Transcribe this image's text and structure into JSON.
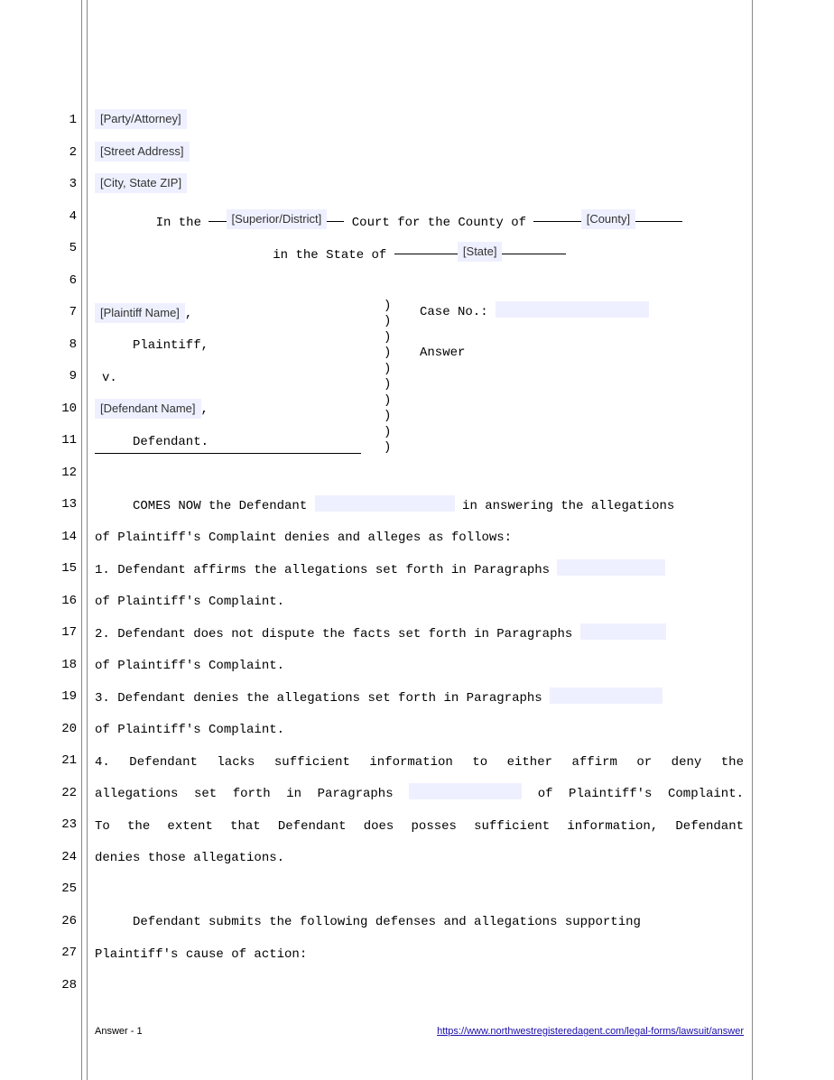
{
  "lineNumbers": [
    "1",
    "2",
    "3",
    "4",
    "5",
    "6",
    "7",
    "8",
    "9",
    "10",
    "11",
    "12",
    "13",
    "14",
    "15",
    "16",
    "17",
    "18",
    "19",
    "20",
    "21",
    "22",
    "23",
    "24",
    "25",
    "26",
    "27",
    "28"
  ],
  "fields": {
    "party": "[Party/Attorney]",
    "street": "[Street Address]",
    "city": "[City, State ZIP]",
    "courtType": "[Superior/District]",
    "county": "[County]",
    "state": "[State]",
    "plaintiff": "[Plaintiff Name]",
    "defendant": "[Defendant Name]"
  },
  "text": {
    "inThe": "In the ",
    "courtFor": " Court for the County of ",
    "inState": "in the State of ",
    "plaintiffComma": ",",
    "plaintiffLabel": "Plaintiff,",
    "v": "v.",
    "defendantComma": ",",
    "defendantLabel": "Defendant.",
    "caseNo": "Case No.:",
    "answer": "Answer",
    "p13a": "COMES NOW the Defendant ",
    "p13b": " in answering the allegations",
    "p14": "of Plaintiff's Complaint denies and alleges as follows:",
    "p15a": "1.   Defendant affirms the allegations set forth in Paragraphs ",
    "p16": "of Plaintiff's Complaint.",
    "p17a": "2.   Defendant does not dispute the facts set forth in Paragraphs ",
    "p18": "of  Plaintiff's Complaint.",
    "p19a": "3.   Defendant denies the allegations set forth in Paragraphs ",
    "p20": "of Plaintiff's Complaint.",
    "p21": "4.   Defendant  lacks  sufficient  information  to  either  affirm  or  deny  the",
    "p22a": "allegations set forth in Paragraphs ",
    "p22b": " of  Plaintiff's Complaint.",
    "p23": "To  the  extent  that  Defendant  does  posses  sufficient  information,  Defendant",
    "p24": "denies those allegations.",
    "p26": "Defendant submits the following defenses and allegations supporting",
    "p27": "Plaintiff's cause of action:"
  },
  "footer": {
    "label": "Answer - 1",
    "link": "https://www.northwestregisteredagent.com/legal-forms/lawsuit/answer"
  }
}
